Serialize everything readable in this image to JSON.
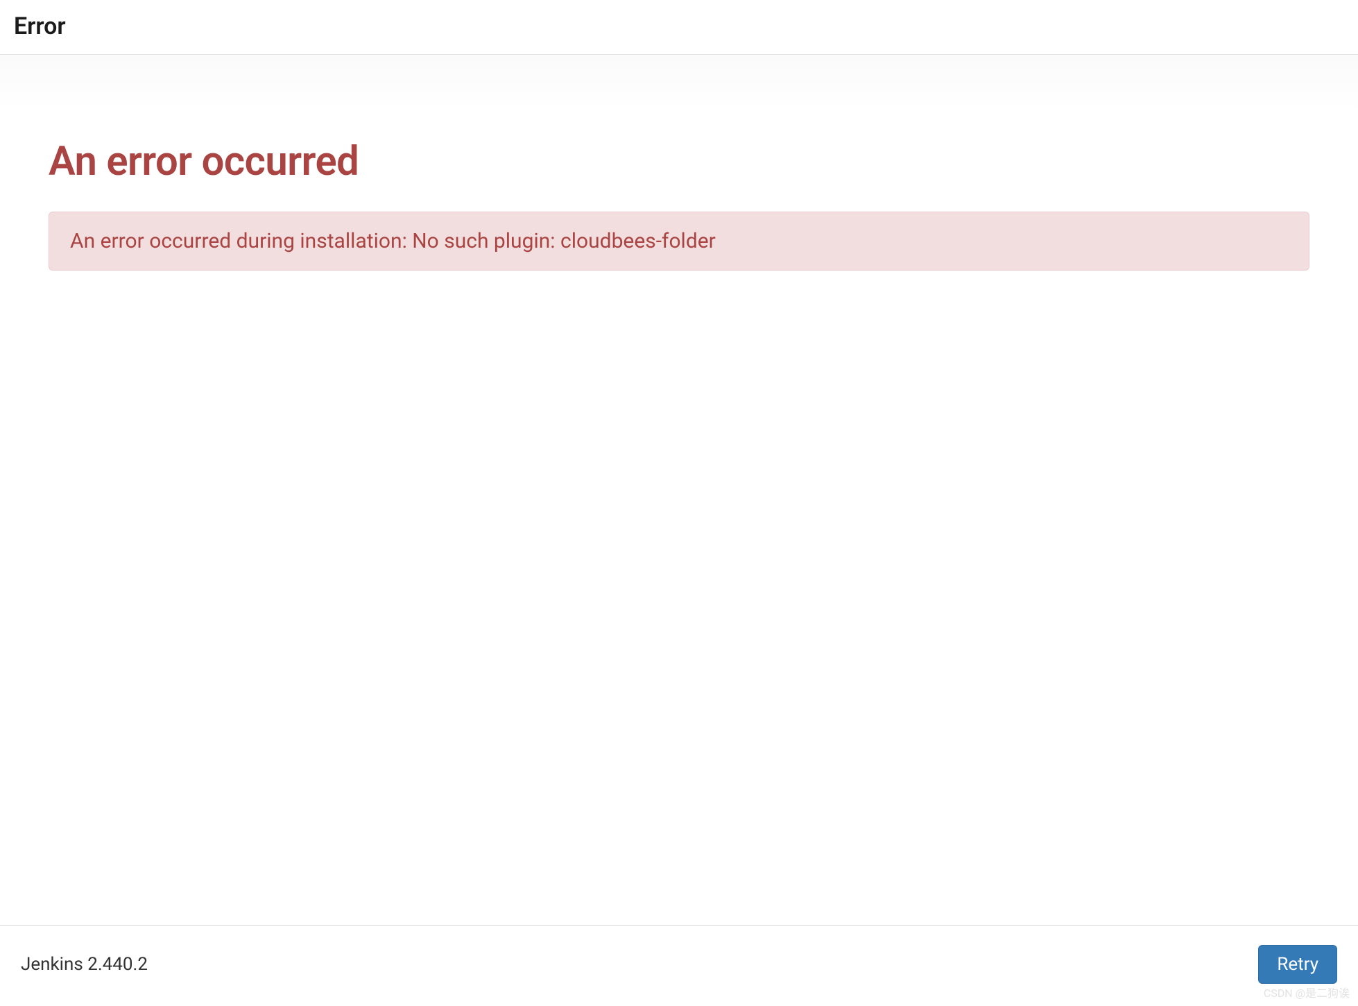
{
  "header": {
    "title": "Error"
  },
  "main": {
    "heading": "An error occurred",
    "alert_message": "An error occurred during installation: No such plugin: cloudbees-folder"
  },
  "footer": {
    "version_text": "Jenkins 2.440.2",
    "retry_label": "Retry"
  },
  "watermark": "CSDN @是二狗诶"
}
